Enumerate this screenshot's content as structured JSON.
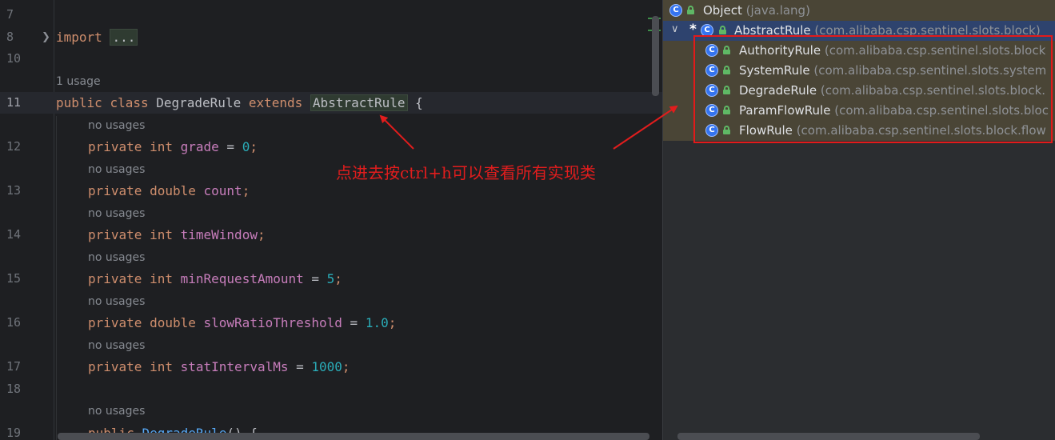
{
  "editor": {
    "fold_placeholder": "...",
    "lines": [
      {
        "no": "7"
      },
      {
        "no": "8",
        "tokens": [
          "import",
          " "
        ],
        "folded": true
      },
      {
        "no": "10"
      },
      {
        "no": "11",
        "tokens": [
          "public",
          " ",
          "class",
          " DegradeRule ",
          "extends",
          " ",
          "AbstractRule",
          " {"
        ]
      },
      {
        "no": "12",
        "tokens": [
          "private",
          " ",
          "int",
          " ",
          "grade",
          " = ",
          "0",
          ";"
        ]
      },
      {
        "no": "13",
        "tokens": [
          "private",
          " ",
          "double",
          " ",
          "count",
          ";"
        ]
      },
      {
        "no": "14",
        "tokens": [
          "private",
          " ",
          "int",
          " ",
          "timeWindow",
          ";"
        ]
      },
      {
        "no": "15",
        "tokens": [
          "private",
          " ",
          "int",
          " ",
          "minRequestAmount",
          " = ",
          "5",
          ";"
        ]
      },
      {
        "no": "16",
        "tokens": [
          "private",
          " ",
          "double",
          " ",
          "slowRatioThreshold",
          " = ",
          "1.0",
          ";"
        ]
      },
      {
        "no": "17",
        "tokens": [
          "private",
          " ",
          "int",
          " ",
          "statIntervalMs",
          " = ",
          "1000",
          ";"
        ]
      },
      {
        "no": "18"
      },
      {
        "no": "19",
        "tokens": [
          "public",
          " ",
          "DegradeRule",
          "() {"
        ]
      }
    ],
    "hints": {
      "usage_class": "1 usage",
      "no_usages": "no usages"
    }
  },
  "annotation": {
    "text": "点进去按ctrl+h可以查看所有实现类",
    "color": "#e11d1d"
  },
  "hierarchy": {
    "items": [
      {
        "name": "Object",
        "pkg": "(java.lang)"
      },
      {
        "name": "AbstractRule",
        "pkg": "(com.alibaba.csp.sentinel.slots.block)",
        "marker": "*",
        "expanded": true
      },
      {
        "name": "AuthorityRule",
        "pkg": "(com.alibaba.csp.sentinel.slots.block"
      },
      {
        "name": "SystemRule",
        "pkg": "(com.alibaba.csp.sentinel.slots.system"
      },
      {
        "name": "DegradeRule",
        "pkg": "(com.alibaba.csp.sentinel.slots.block."
      },
      {
        "name": "ParamFlowRule",
        "pkg": "(com.alibaba.csp.sentinel.slots.bloc"
      },
      {
        "name": "FlowRule",
        "pkg": "(com.alibaba.csp.sentinel.slots.block.flow"
      }
    ],
    "class_icon_letter": "C",
    "highlight_color": "#e21a1a"
  },
  "colors": {
    "keyword": "#cf8e6d",
    "field": "#c77dbb",
    "number": "#2aacb8",
    "method": "#56a8f5",
    "editor_bg": "#1e1f22",
    "hierarchy_top_bg": "#4a4536",
    "selection": "#2e436e"
  }
}
